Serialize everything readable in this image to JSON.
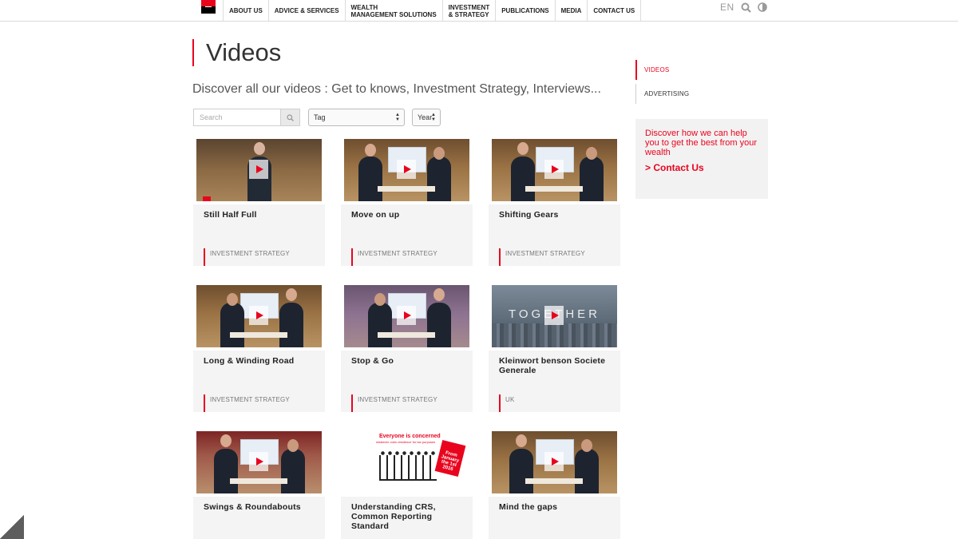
{
  "nav": {
    "items": [
      {
        "label": "ABOUT US"
      },
      {
        "label": "ADVICE & SERVICES"
      },
      {
        "label": "WEALTH\nMANAGEMENT SOLUTIONS"
      },
      {
        "label": "INVESTMENT\n& STRATEGY"
      },
      {
        "label": "PUBLICATIONS"
      },
      {
        "label": "MEDIA"
      },
      {
        "label": "CONTACT US"
      }
    ],
    "lang": "EN",
    "brand_color": "#e9041e"
  },
  "page": {
    "title": "Videos",
    "subtitle": "Discover all our videos : Get to knows, Investment Strategy, Interviews..."
  },
  "filters": {
    "search_placeholder": "Search",
    "tag_value": "Tag",
    "year_value": "Year"
  },
  "videos": [
    {
      "title": "Still Half Full",
      "tag": "INVESTMENT STRATEGY"
    },
    {
      "title": "Move on up",
      "tag": "INVESTMENT STRATEGY"
    },
    {
      "title": "Shifting Gears",
      "tag": "INVESTMENT STRATEGY"
    },
    {
      "title": "Long & Winding Road",
      "tag": "INVESTMENT STRATEGY"
    },
    {
      "title": "Stop & Go",
      "tag": "INVESTMENT STRATEGY"
    },
    {
      "title": "Kleinwort benson Societe Generale",
      "tag": "UK",
      "thumb_text": "TOGETHER"
    },
    {
      "title": "Swings & Roundabouts",
      "tag": ""
    },
    {
      "title": "Understanding CRS, Common Reporting Standard",
      "tag": "",
      "thumb_text": "Everyone is concerned",
      "thumb_subtext": "whatever ones residence for tax purposes",
      "badge_text": "From January the 1st 2016"
    },
    {
      "title": "Mind the gaps",
      "tag": ""
    }
  ],
  "sidebar": {
    "items": [
      {
        "label": "VIDEOS"
      },
      {
        "label": "ADVERTISING"
      }
    ],
    "promo_text": "Discover how we can help you to get the best from your wealth",
    "promo_link": "> Contact Us"
  }
}
